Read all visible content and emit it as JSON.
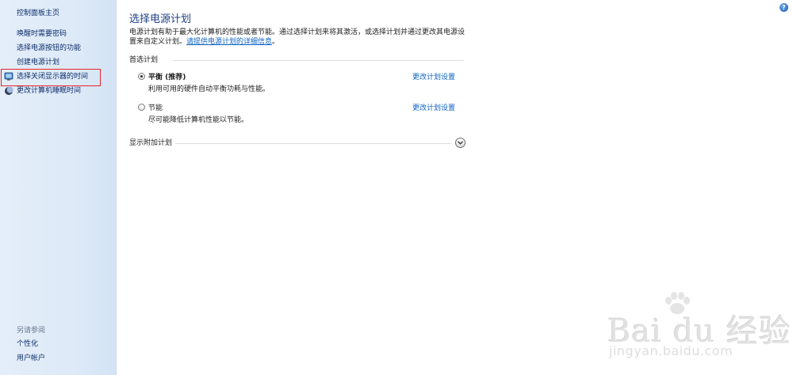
{
  "help": {
    "label": "?"
  },
  "sidebar": {
    "links": [
      {
        "label": "控制面板主页"
      },
      {
        "label": "唤醒时需要密码"
      },
      {
        "label": "选择电源按钮的功能"
      },
      {
        "label": "创建电源计划"
      },
      {
        "label": "选择关闭显示器的时间",
        "icon": "monitor-icon"
      },
      {
        "label": "更改计算机睡眠时间",
        "icon": "moon-icon"
      }
    ],
    "see_also": {
      "header": "另请参阅",
      "links": [
        {
          "label": "个性化"
        },
        {
          "label": "用户帐户"
        }
      ]
    }
  },
  "main": {
    "title": "选择电源计划",
    "intro": "电源计划有助于最大化计算机的性能或者节能。通过选择计划来将其激活，或选择计划并通过更改其电源设置来自定义计划。",
    "intro_link": "请提供电源计划的详细信息",
    "intro_end": "。",
    "preferred_header": "首选计划",
    "plans": [
      {
        "name": "平衡 (推荐)",
        "description": "利用可用的硬件自动平衡功耗与性能。",
        "change_link": "更改计划设置",
        "selected": true
      },
      {
        "name": "节能",
        "description": "尽可能降低计算机性能以节能。",
        "change_link": "更改计划设置",
        "selected": false
      }
    ],
    "show_more": "显示附加计划"
  },
  "watermark": {
    "brand": "Bai du 经验",
    "url": "jingyan.baidu.com"
  },
  "colors": {
    "link": "#0b62c4",
    "title": "#1e3f85",
    "highlight_box": "#e8232d"
  }
}
